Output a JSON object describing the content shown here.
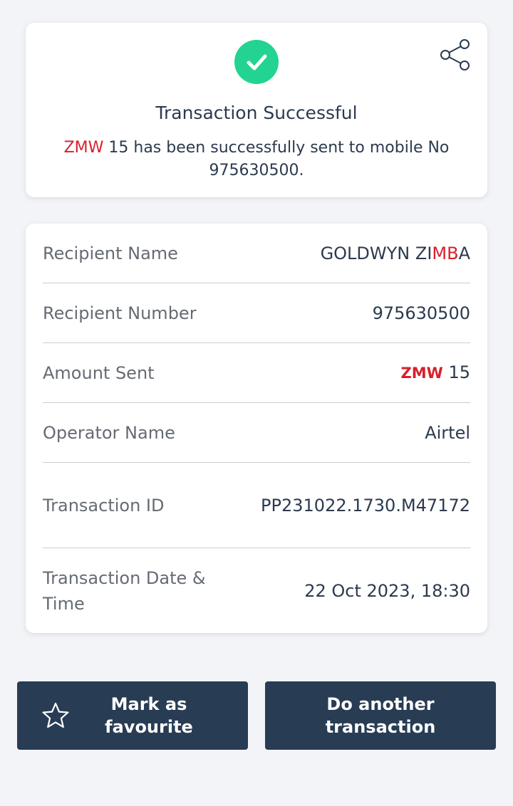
{
  "success": {
    "title": "Transaction Successful",
    "currency": "ZMW",
    "message_rest": " 15 has been successfully sent to mobile No 975630500."
  },
  "details": [
    {
      "label": "Recipient Name",
      "value_part1": "GOLDWYN ZI",
      "value_part2": "MB",
      "value_part3": "A"
    },
    {
      "label": "Recipient Number",
      "value": "975630500"
    },
    {
      "label": "Amount Sent",
      "currency": "ZMW",
      "amount": "15"
    },
    {
      "label": "Operator Name",
      "value": "Airtel"
    },
    {
      "label": "Transaction ID",
      "value": "PP231022.1730.M47172"
    },
    {
      "label": "Transaction Date & Time",
      "value": "22 Oct 2023, 18:30"
    }
  ],
  "buttons": {
    "favourite": "Mark as favourite",
    "another": "Do another transaction"
  },
  "colors": {
    "accent_red": "#d8202c",
    "success_green": "#22d48f",
    "button_navy": "#283c54"
  },
  "icons": {
    "check": "check-icon",
    "share": "share-icon",
    "star": "star-icon"
  }
}
